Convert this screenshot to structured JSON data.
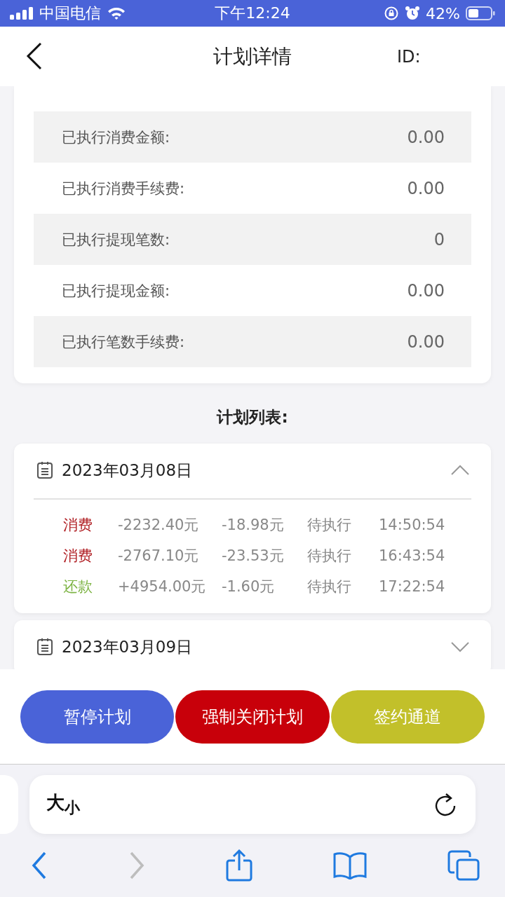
{
  "status_bar": {
    "carrier": "中国电信",
    "time": "下午12:24",
    "battery": "42%"
  },
  "header": {
    "title": "计划详情",
    "id_label": "ID:"
  },
  "stats": [
    {
      "label": "已执行消费金额:",
      "value": "0.00"
    },
    {
      "label": "已执行消费手续费:",
      "value": "0.00"
    },
    {
      "label": "已执行提现笔数:",
      "value": "0"
    },
    {
      "label": "已执行提现金额:",
      "value": "0.00"
    },
    {
      "label": "已执行笔数手续费:",
      "value": "0.00"
    }
  ],
  "plan_list": {
    "title": "计划列表:",
    "days": [
      {
        "date": "2023年03月08日",
        "expanded": true,
        "records": [
          {
            "type": "消费",
            "color": "#b01e23",
            "amount": "-2232.40元",
            "fee": "-18.98元",
            "status": "待执行",
            "time": "14:50:54"
          },
          {
            "type": "消费",
            "color": "#b01e23",
            "amount": "-2767.10元",
            "fee": "-23.53元",
            "status": "待执行",
            "time": "16:43:54"
          },
          {
            "type": "还款",
            "color": "#7cb342",
            "amount": "+4954.00元",
            "fee": "-1.60元",
            "status": "待执行",
            "time": "17:22:54"
          }
        ]
      },
      {
        "date": "2023年03月09日",
        "expanded": false
      }
    ]
  },
  "actions": [
    {
      "label": "暂停计划",
      "color": "#4a63d8"
    },
    {
      "label": "强制关闭计划",
      "color": "#c8000a"
    },
    {
      "label": "签约通道",
      "color": "#c2c02a"
    }
  ],
  "browser": {
    "address_label": "大$_{小}$",
    "forward_disabled": true
  }
}
